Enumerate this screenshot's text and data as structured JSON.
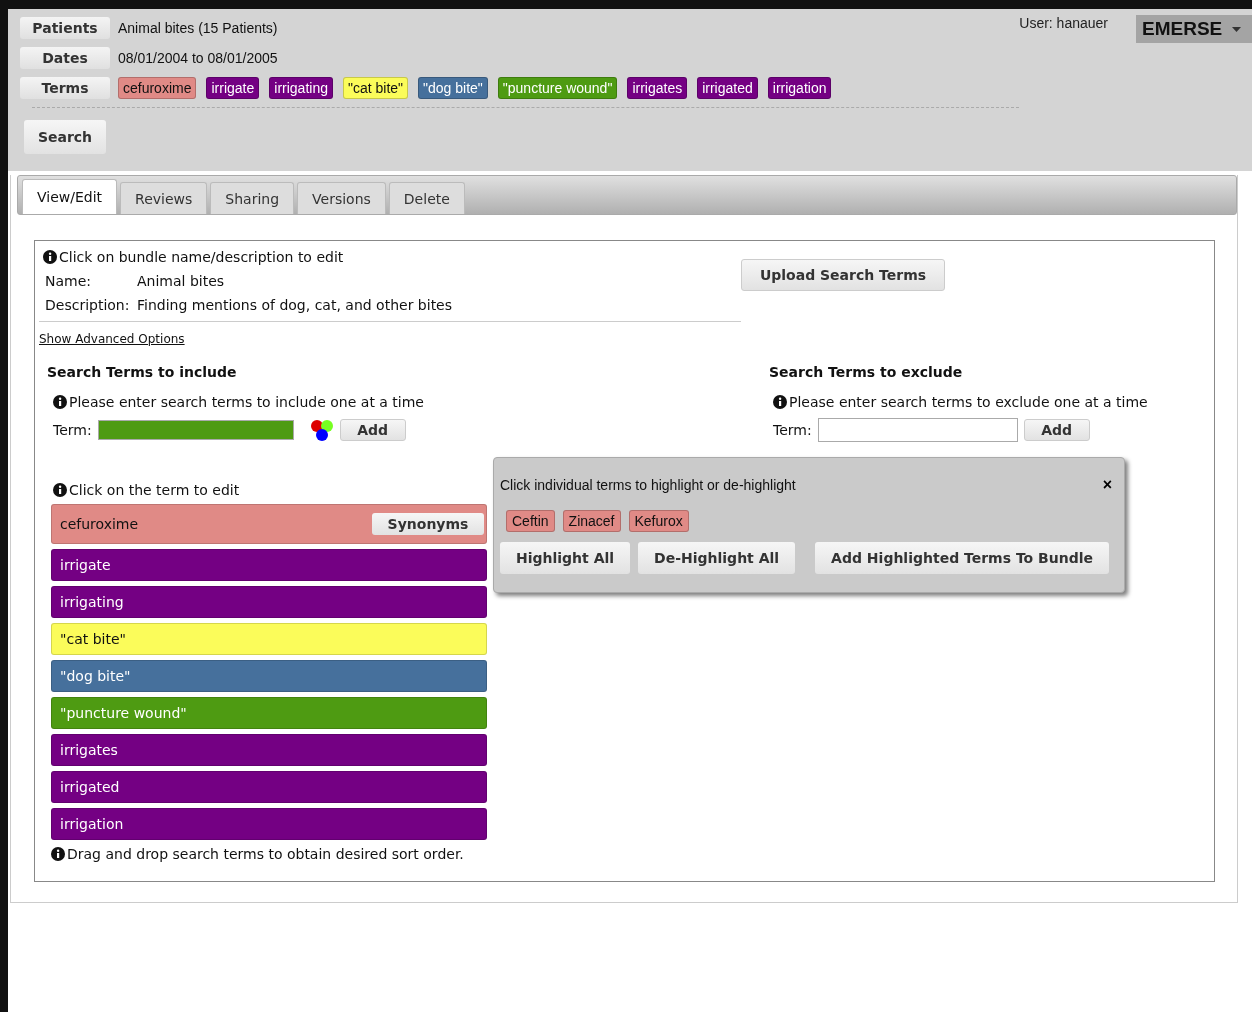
{
  "header": {
    "rows": [
      {
        "label": "Patients",
        "value": "Animal bites (15 Patients)"
      },
      {
        "label": "Dates",
        "value": "08/01/2004 to 08/01/2005"
      }
    ],
    "terms_label": "Terms",
    "terms": [
      {
        "text": "cefuroxime",
        "color": "#e08a86"
      },
      {
        "text": "irrigate",
        "color": "#740083"
      },
      {
        "text": "irrigating",
        "color": "#740083"
      },
      {
        "text": "\"cat bite\"",
        "color": "#fbfc5a"
      },
      {
        "text": "\"dog bite\"",
        "color": "#46709c"
      },
      {
        "text": "\"puncture wound\"",
        "color": "#4e9b12"
      },
      {
        "text": "irrigates",
        "color": "#740083"
      },
      {
        "text": "irrigated",
        "color": "#740083"
      },
      {
        "text": "irrigation",
        "color": "#740083"
      }
    ],
    "search_button": "Search",
    "user": "User: hanauer",
    "app_menu": "EMERSE"
  },
  "tabs": [
    {
      "label": "View/Edit",
      "selected": true
    },
    {
      "label": "Reviews",
      "selected": false
    },
    {
      "label": "Sharing",
      "selected": false
    },
    {
      "label": "Versions",
      "selected": false
    },
    {
      "label": "Delete",
      "selected": false
    }
  ],
  "bundle": {
    "hint": "Click on bundle name/description to edit",
    "name_label": "Name:",
    "name": "Animal bites",
    "description_label": "Description:",
    "description": "Finding mentions of dog, cat, and other bites",
    "advanced_link": "Show Advanced Options",
    "upload_button": "Upload Search Terms"
  },
  "include": {
    "title": "Search Terms to include",
    "hint": "Please enter search terms to include one at a time",
    "term_label": "Term:",
    "term_input": {
      "color": "#4e9b12"
    },
    "add_button": "Add",
    "edit_hint": "Click on the term to edit",
    "synonyms_button": "Synonyms",
    "terms": [
      {
        "text": "cefuroxime",
        "color": "#e08a86"
      },
      {
        "text": "irrigate",
        "color": "#740083"
      },
      {
        "text": "irrigating",
        "color": "#740083"
      },
      {
        "text": "\"cat bite\"",
        "color": "#fbfc5a"
      },
      {
        "text": "\"dog bite\"",
        "color": "#46709c"
      },
      {
        "text": "\"puncture wound\"",
        "color": "#4e9b12"
      },
      {
        "text": "irrigates",
        "color": "#740083"
      },
      {
        "text": "irrigated",
        "color": "#740083"
      },
      {
        "text": "irrigation",
        "color": "#740083"
      }
    ],
    "drag_hint": "Drag and drop search terms to obtain desired sort order."
  },
  "exclude": {
    "title": "Search Terms to exclude",
    "hint": "Please enter search terms to exclude one at a time",
    "term_label": "Term:",
    "add_button": "Add"
  },
  "synonym_popup": {
    "instruction": "Click individual terms to highlight or de-highlight",
    "close": "×",
    "synonyms": [
      {
        "text": "Ceftin",
        "color": "#e08a86"
      },
      {
        "text": "Zinacef",
        "color": "#e08a86"
      },
      {
        "text": "Kefurox",
        "color": "#e08a86"
      }
    ],
    "buttons": [
      "Highlight All",
      "De-Highlight All",
      "Add Highlighted Terms To Bundle"
    ]
  }
}
